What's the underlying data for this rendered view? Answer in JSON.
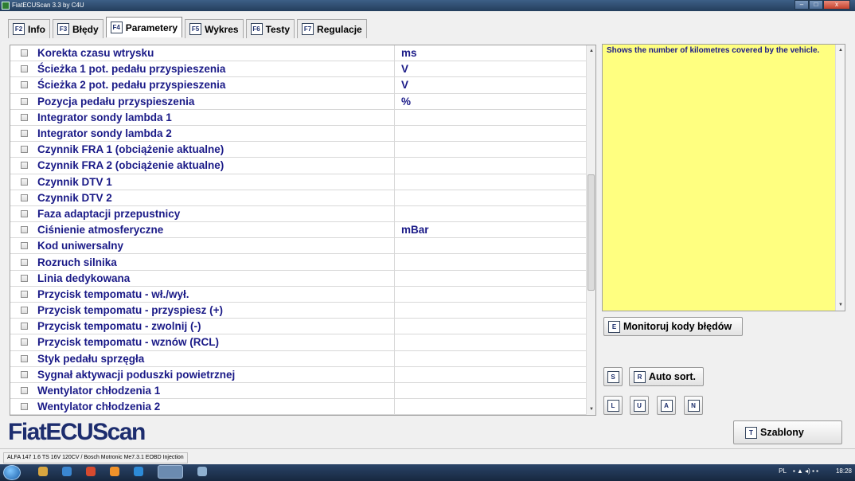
{
  "window": {
    "title": "FiatECUScan 3.3 by C4U",
    "controls": [
      "–",
      "□",
      "x"
    ]
  },
  "tabs": [
    {
      "key": "F2",
      "label": "Info"
    },
    {
      "key": "F3",
      "label": "Błędy"
    },
    {
      "key": "F4",
      "label": "Parametery",
      "active": true
    },
    {
      "key": "F5",
      "label": "Wykres"
    },
    {
      "key": "F6",
      "label": "Testy"
    },
    {
      "key": "F7",
      "label": "Regulacje"
    }
  ],
  "params": [
    {
      "name": "Korekta czasu wtrysku",
      "unit": "ms"
    },
    {
      "name": "Ścieżka 1 pot. pedału przyspieszenia",
      "unit": "V"
    },
    {
      "name": "Ścieżka 2 pot. pedału przyspieszenia",
      "unit": "V"
    },
    {
      "name": "Pozycja pedału przyspieszenia",
      "unit": "%"
    },
    {
      "name": "Integrator sondy lambda 1",
      "unit": ""
    },
    {
      "name": "Integrator sondy lambda 2",
      "unit": ""
    },
    {
      "name": "Czynnik FRA 1 (obciążenie aktualne)",
      "unit": ""
    },
    {
      "name": "Czynnik FRA 2 (obciążenie aktualne)",
      "unit": ""
    },
    {
      "name": "Czynnik DTV 1",
      "unit": ""
    },
    {
      "name": "Czynnik DTV 2",
      "unit": ""
    },
    {
      "name": "Faza adaptacji przepustnicy",
      "unit": ""
    },
    {
      "name": "Ciśnienie atmosferyczne",
      "unit": "mBar"
    },
    {
      "name": "Kod uniwersalny",
      "unit": ""
    },
    {
      "name": "Rozruch silnika",
      "unit": ""
    },
    {
      "name": "Linia dedykowana",
      "unit": ""
    },
    {
      "name": "Przycisk tempomatu - wł./wył.",
      "unit": ""
    },
    {
      "name": "Przycisk tempomatu - przyspiesz (+)",
      "unit": ""
    },
    {
      "name": "Przycisk tempomatu - zwolnij (-)",
      "unit": ""
    },
    {
      "name": "Przycisk tempomatu - wznów (RCL)",
      "unit": ""
    },
    {
      "name": "Styk pedału sprzęgła",
      "unit": ""
    },
    {
      "name": "Sygnał aktywacji poduszki powietrznej",
      "unit": ""
    },
    {
      "name": "Wentylator chłodzenia 1",
      "unit": ""
    },
    {
      "name": "Wentylator chłodzenia 2",
      "unit": ""
    }
  ],
  "description": "Shows the number of kilometres covered by the vehicle.",
  "buttons": {
    "monitor": {
      "key": "E",
      "label": "Monitoruj kody błędów"
    },
    "s": {
      "key": "S"
    },
    "autosort": {
      "key": "R",
      "label": "Auto sort."
    },
    "l": {
      "key": "L"
    },
    "u": {
      "key": "U"
    },
    "a": {
      "key": "A"
    },
    "n": {
      "key": "N"
    },
    "szablony": {
      "key": "T",
      "label": "Szablony"
    }
  },
  "logo": "FiatECUScan",
  "status": "ALFA 147 1.6 TS 16V 120CV / Bosch Motronic Me7.3.1 EOBD Injection",
  "taskbar": {
    "lang": "PL",
    "clock": "18:28"
  },
  "colors": {
    "list_text": "#1a1a87",
    "desc_bg": "#ffff80",
    "logo": "#1d2d6e"
  }
}
